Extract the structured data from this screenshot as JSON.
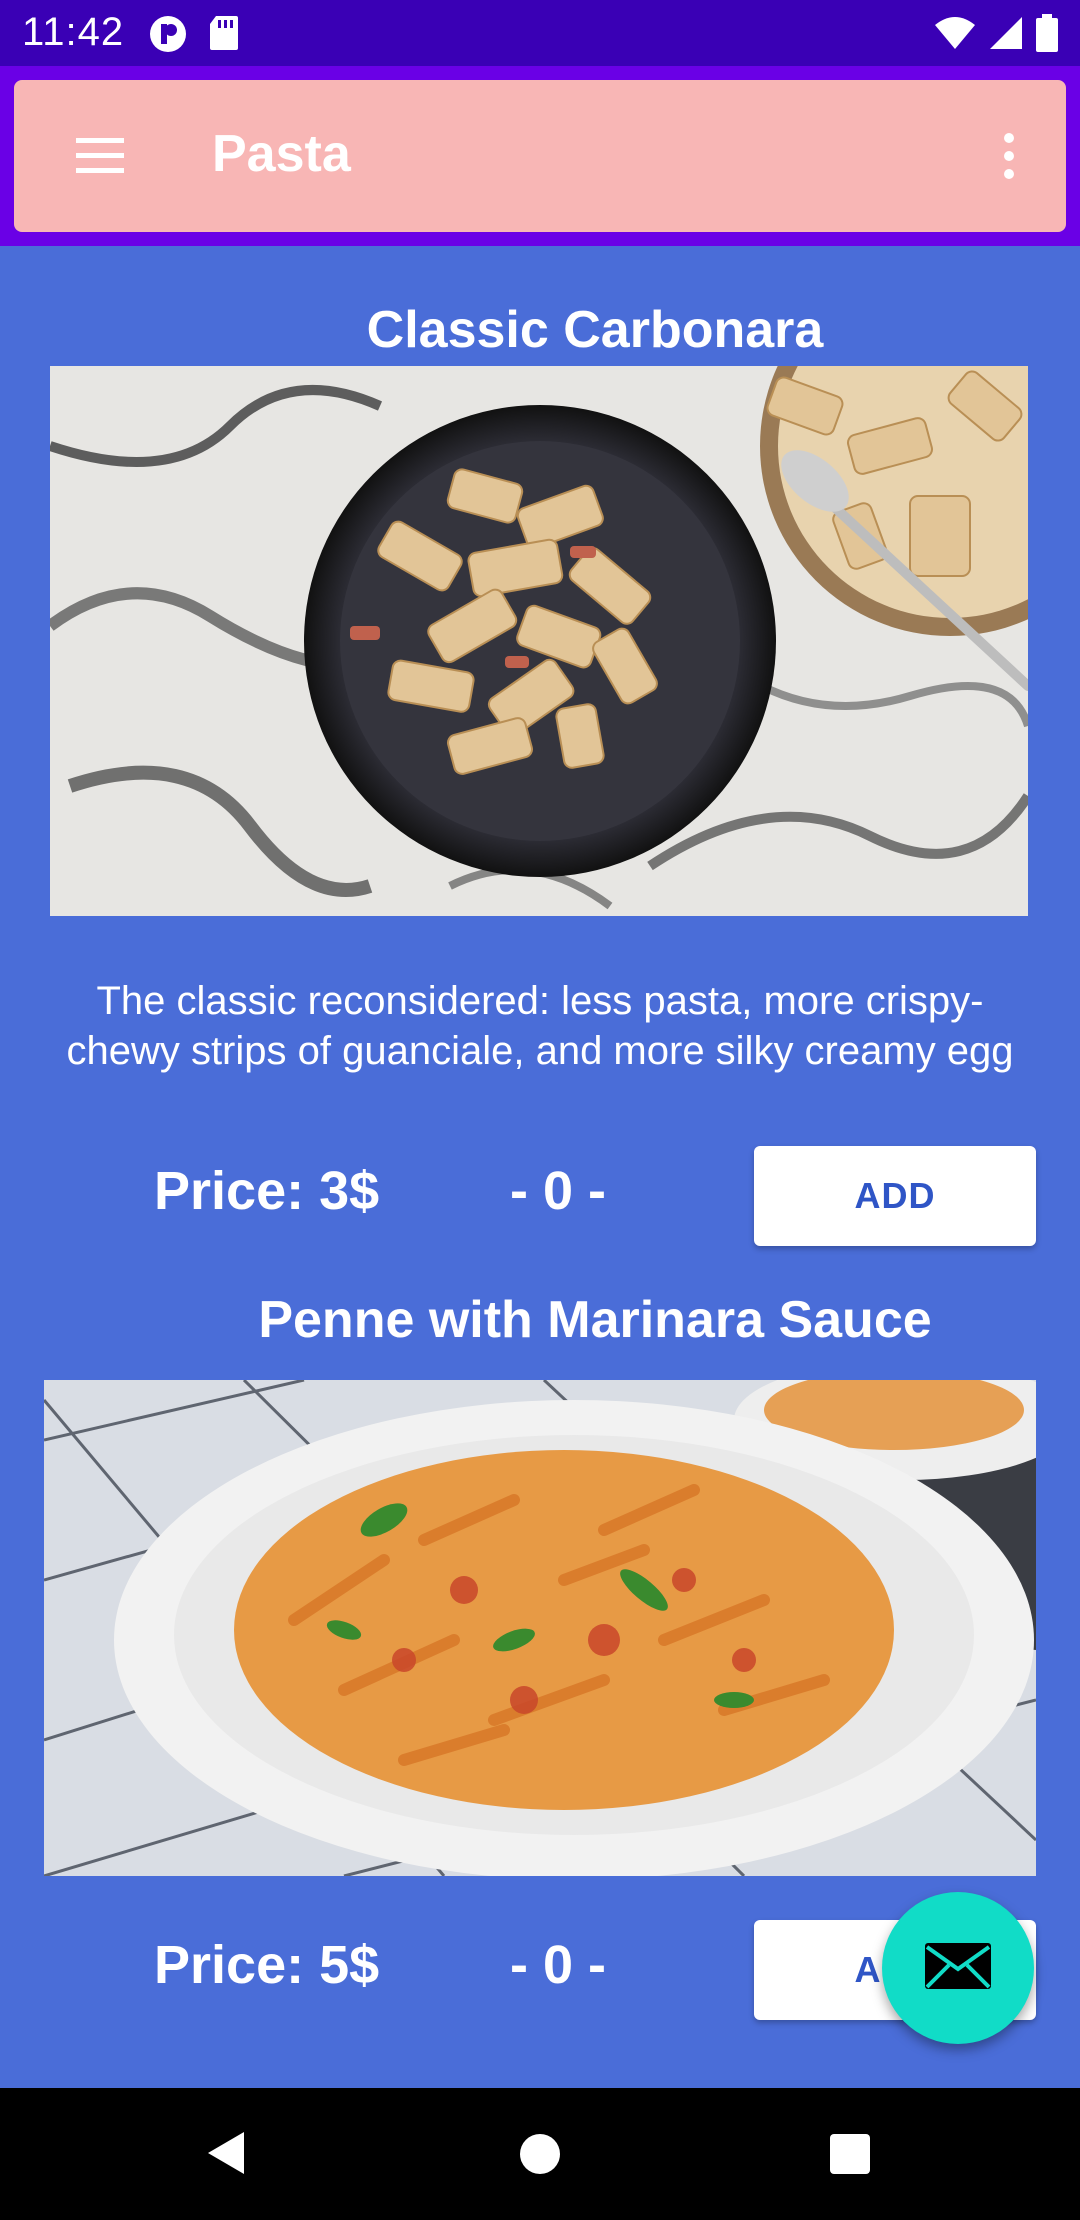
{
  "status_bar": {
    "time": "11:42"
  },
  "app_bar": {
    "title": "Pasta",
    "menu_icon": "hamburger-menu-icon",
    "overflow_icon": "more-vert-icon"
  },
  "items": [
    {
      "title": "Classic Carbonara",
      "description": "The classic reconsidered: less pasta, more crispy-chewy strips of guanciale, and more silky creamy egg",
      "price": "Price: 3$",
      "quantity": "- 0 -",
      "add_label": "ADD",
      "image": "carbonara-photo"
    },
    {
      "title": "Penne with Marinara Sauce",
      "description": "",
      "price": "Price: 5$",
      "quantity": "- 0 -",
      "add_label": "ADD",
      "image": "penne-marinara-photo"
    }
  ],
  "fab": {
    "icon": "mail-icon"
  },
  "colors": {
    "background": "#4a6dd8",
    "status_bar": "#3a00b5",
    "app_bar_frame": "#6a00e6",
    "app_bar": "#f8b6b5",
    "fab": "#11dcc7",
    "button_text": "#2f55c6"
  }
}
